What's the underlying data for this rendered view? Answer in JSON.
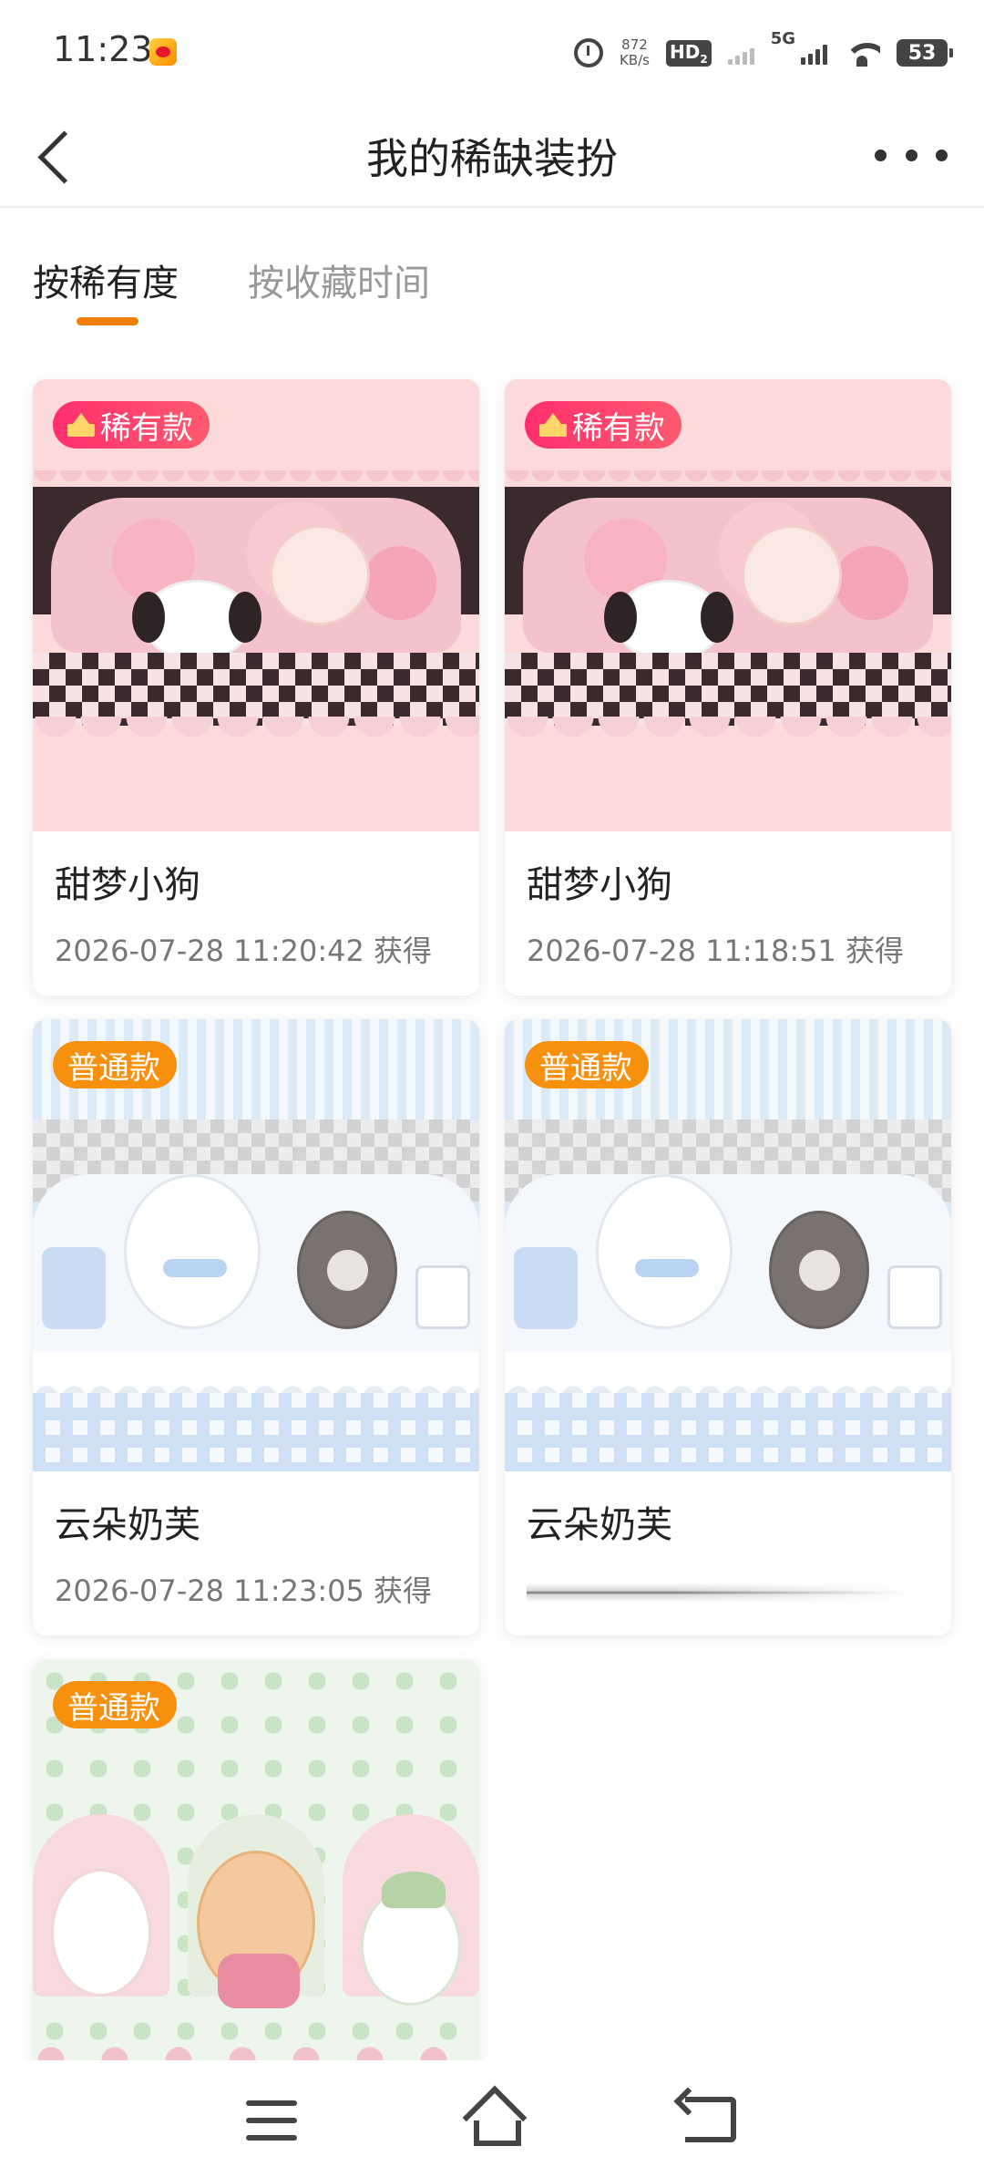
{
  "status_bar": {
    "time": "11:23",
    "net_speed_value": "872",
    "net_speed_unit": "KB/s",
    "hd_label": "HD",
    "hd_sub": "2",
    "network_label": "5G",
    "battery": "53"
  },
  "header": {
    "title": "我的稀缺装扮",
    "back_icon": "chevron-left-icon",
    "more_icon": "more-dots-icon"
  },
  "tabs": [
    {
      "label": "按稀有度",
      "active": true
    },
    {
      "label": "按收藏时间",
      "active": false
    }
  ],
  "colors": {
    "accent": "#f07f0a",
    "rare_badge": "#ff2f6e",
    "normal_badge": "#f7900c"
  },
  "cards": [
    {
      "badge": "稀有款",
      "badge_type": "rare",
      "title": "甜梦小狗",
      "time": "2026-07-28 11:20:42 获得",
      "art": "pink"
    },
    {
      "badge": "稀有款",
      "badge_type": "rare",
      "title": "甜梦小狗",
      "time": "2026-07-28 11:18:51 获得",
      "art": "pink"
    },
    {
      "badge": "普通款",
      "badge_type": "normal",
      "title": "云朵奶芙",
      "time": "2026-07-28 11:23:05 获得",
      "art": "blue"
    },
    {
      "badge": "普通款",
      "badge_type": "normal",
      "title": "云朵奶芙",
      "time": "",
      "loading": true,
      "art": "blue"
    },
    {
      "badge": "普通款",
      "badge_type": "normal",
      "title": "",
      "time": "",
      "art": "green"
    }
  ],
  "nav": {
    "menu_icon": "menu-icon",
    "home_icon": "home-icon",
    "back_icon": "back-icon"
  }
}
